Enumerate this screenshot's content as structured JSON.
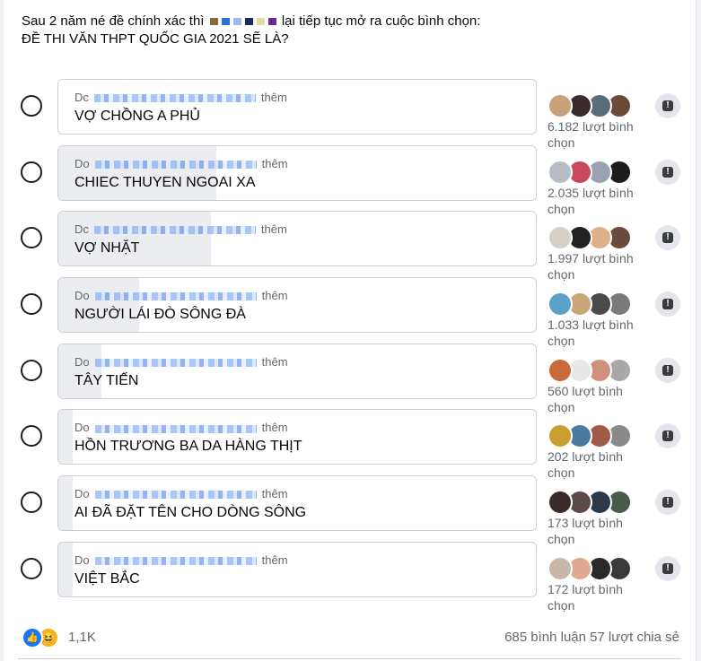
{
  "post": {
    "line1_a": "Sau 2 năm né đề chính xác thì",
    "line1_b": "lại tiếp tục mở ra cuộc bình chọn:",
    "line2": "ĐỀ THI VĂN THPT QUỐC GIA 2021 SẼ LÀ?"
  },
  "poll": {
    "options": [
      {
        "added_prefix": "Dc",
        "added_suffix": "thêm",
        "label": "VỢ CHỒNG A PHỦ",
        "votes_number": "6.182",
        "votes_text": "lượt bình chọn",
        "share": 0.0
      },
      {
        "added_prefix": "Do",
        "added_suffix": "thêm",
        "label": "CHIEC THUYEN NGOAI XA",
        "votes_number": "2.035",
        "votes_text": "lượt bình chọn",
        "share": 0.33
      },
      {
        "added_prefix": "Dc",
        "added_suffix": "thêm",
        "label": "VỢ NHẶT",
        "votes_number": "1.997",
        "votes_text": "lượt bình chọn",
        "share": 0.32
      },
      {
        "added_prefix": "Do",
        "added_suffix": "thêm",
        "label": "NGƯỜI LÁI ĐÒ SÔNG ĐÀ",
        "votes_number": "1.033",
        "votes_text": "lượt bình chọn",
        "share": 0.17
      },
      {
        "added_prefix": "Do",
        "added_suffix": "thêm",
        "label": "TÂY TIẾN",
        "votes_number": "560",
        "votes_text": "lượt bình chọn",
        "share": 0.09
      },
      {
        "added_prefix": "Do",
        "added_suffix": "thêm",
        "label": "HỒN TRƯƠNG BA DA HÀNG THỊT",
        "votes_number": "202",
        "votes_text": "lượt bình chọn",
        "share": 0.03
      },
      {
        "added_prefix": "Do",
        "added_suffix": "thêm",
        "label": "AI ĐÃ ĐẶT TÊN CHO DÒNG SÔNG",
        "votes_number": "173",
        "votes_text": "lượt bình chọn",
        "share": 0.03
      },
      {
        "added_prefix": "Do",
        "added_suffix": "thêm",
        "label": "VIỆT BẮC",
        "votes_number": "172",
        "votes_text": "lượt bình chọn",
        "share": 0.03
      }
    ]
  },
  "footer": {
    "reactions_count": "1,1K",
    "comments": "685 bình luận",
    "shares": "57 lượt chia sẻ"
  },
  "icons": {
    "like": "like-icon",
    "haha": "haha-icon",
    "alert": "alert-icon"
  },
  "colors": {
    "like_blue": "#1877f2",
    "haha_yellow": "#f7b125",
    "bar_fill": "#ebedf0"
  }
}
